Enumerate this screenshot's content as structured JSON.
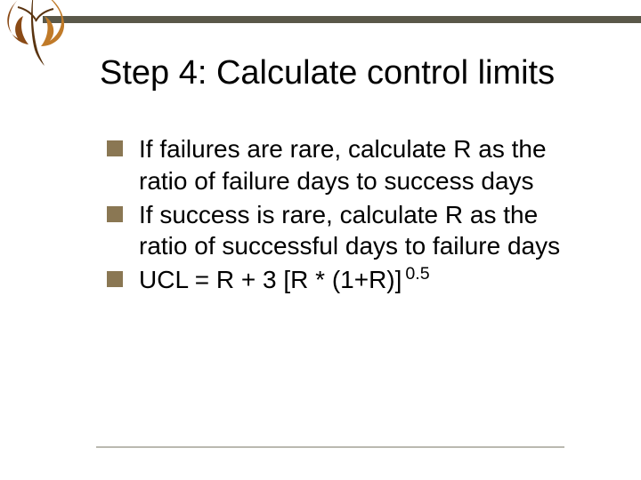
{
  "title": "Step 4: Calculate control limits",
  "bullets": [
    {
      "text": "If failures are rare, calculate R as the ratio of failure days to success days"
    },
    {
      "text": "If success is rare, calculate R as the ratio of successful days to failure days"
    },
    {
      "text": "UCL = R + 3 [R * (1+R)]",
      "sup": "0.5"
    }
  ],
  "colors": {
    "top_bar": "#5a5849",
    "bullet": "#8a7753",
    "leaf_main": "#b06a1e",
    "leaf_dark": "#6b3e14"
  }
}
